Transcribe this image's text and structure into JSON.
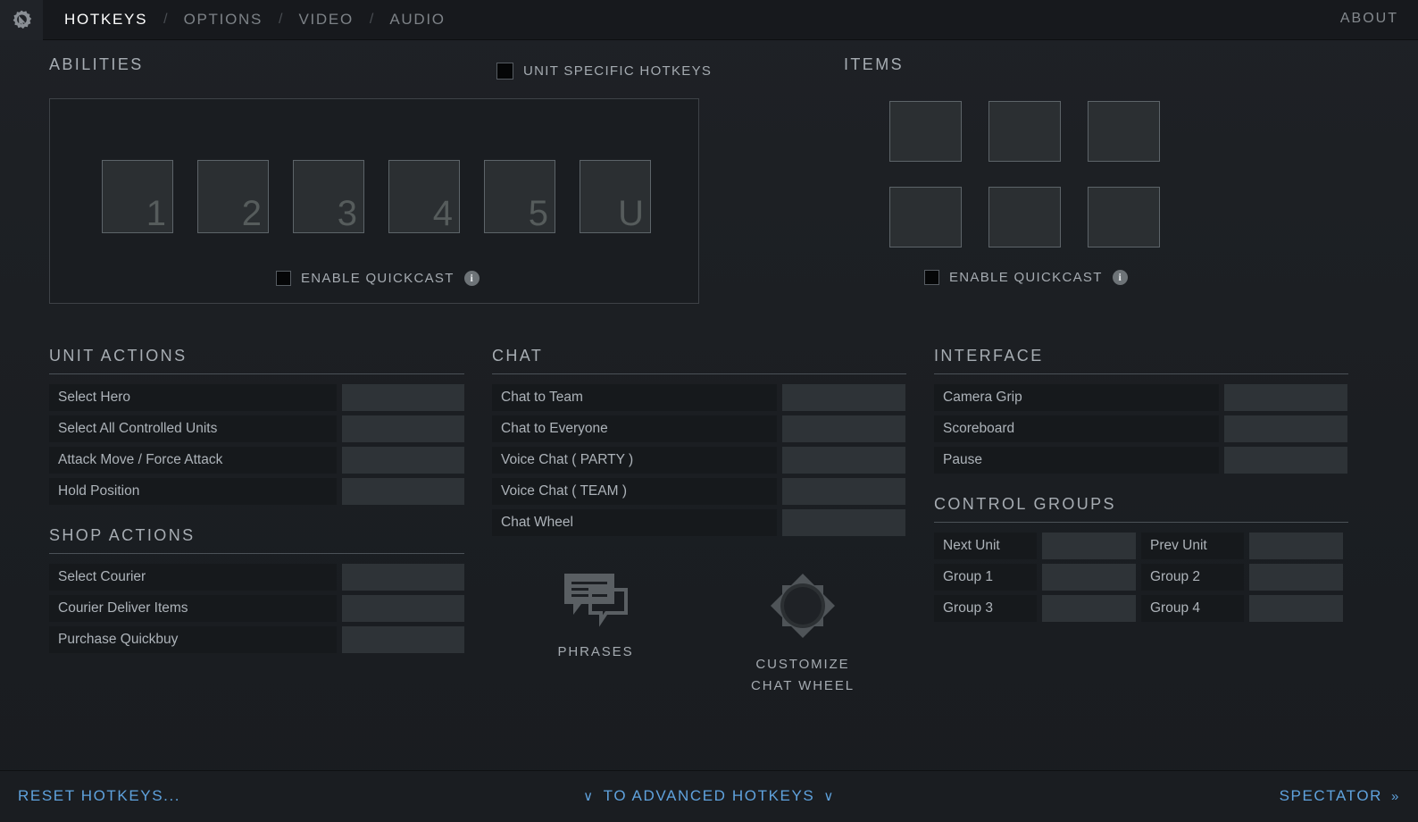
{
  "nav": {
    "gear_icon": "gear-cursor-icon",
    "tabs": [
      {
        "label": "HOTKEYS",
        "active": true
      },
      {
        "label": "OPTIONS",
        "active": false
      },
      {
        "label": "VIDEO",
        "active": false
      },
      {
        "label": "AUDIO",
        "active": false
      }
    ],
    "separator": "/",
    "about": "ABOUT"
  },
  "abilities": {
    "heading": "ABILITIES",
    "unit_specific": {
      "label": "UNIT SPECIFIC HOTKEYS",
      "checked": false
    },
    "slots": [
      "1",
      "2",
      "3",
      "4",
      "5",
      "U"
    ],
    "quickcast": {
      "label": "ENABLE QUICKCAST",
      "checked": false,
      "info_icon": "info-icon"
    }
  },
  "items": {
    "heading": "ITEMS",
    "slots": [
      "",
      "",
      "",
      "",
      "",
      ""
    ],
    "quickcast": {
      "label": "ENABLE QUICKCAST",
      "checked": false,
      "info_icon": "info-icon"
    }
  },
  "unit_actions": {
    "heading": "UNIT ACTIONS",
    "rows": [
      {
        "label": "Select Hero",
        "value": ""
      },
      {
        "label": "Select All Controlled Units",
        "value": ""
      },
      {
        "label": "Attack Move / Force Attack",
        "value": ""
      },
      {
        "label": "Hold Position",
        "value": ""
      }
    ]
  },
  "shop_actions": {
    "heading": "SHOP ACTIONS",
    "rows": [
      {
        "label": "Select Courier",
        "value": ""
      },
      {
        "label": "Courier Deliver Items",
        "value": ""
      },
      {
        "label": "Purchase Quickbuy",
        "value": ""
      }
    ]
  },
  "chat": {
    "heading": "CHAT",
    "rows": [
      {
        "label": "Chat to Team",
        "value": ""
      },
      {
        "label": "Chat to Everyone",
        "value": ""
      },
      {
        "label": "Voice Chat ( PARTY )",
        "value": ""
      },
      {
        "label": "Voice Chat ( TEAM )",
        "value": ""
      },
      {
        "label": "Chat Wheel",
        "value": ""
      }
    ],
    "buttons": [
      {
        "caption": "PHRASES",
        "icon": "speech-bubbles-icon"
      },
      {
        "caption": "CUSTOMIZE\nCHAT WHEEL",
        "caption_line1": "CUSTOMIZE",
        "caption_line2": "CHAT WHEEL",
        "icon": "chat-wheel-icon"
      }
    ]
  },
  "interface": {
    "heading": "INTERFACE",
    "rows": [
      {
        "label": "Camera Grip",
        "value": ""
      },
      {
        "label": "Scoreboard",
        "value": ""
      },
      {
        "label": "Pause",
        "value": ""
      }
    ]
  },
  "control_groups": {
    "heading": "CONTROL GROUPS",
    "rows": [
      {
        "left_label": "Next Unit",
        "left_value": "",
        "right_label": "Prev Unit",
        "right_value": ""
      },
      {
        "left_label": "Group 1",
        "left_value": "",
        "right_label": "Group 2",
        "right_value": ""
      },
      {
        "left_label": "Group 3",
        "left_value": "",
        "right_label": "Group 4",
        "right_value": ""
      }
    ]
  },
  "footer": {
    "reset": "RESET HOTKEYS...",
    "advanced": "TO ADVANCED HOTKEYS",
    "advanced_chevron": "∨",
    "spectator": "SPECTATOR",
    "spectator_chevron": "»"
  },
  "colors": {
    "accent_link": "#5fa2dd",
    "page_bg": "#1c1f23",
    "topbar_bg": "#17191d",
    "row_label_bg": "#16191c",
    "row_value_bg": "#2e3337",
    "key_bg": "#2b2f32",
    "key_border": "#5d6469",
    "heading_text": "#a7adb3",
    "rule": "#4b5157"
  }
}
